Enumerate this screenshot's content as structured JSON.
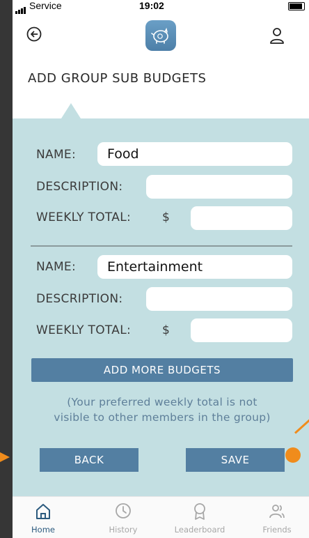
{
  "status_bar": {
    "carrier": "Service",
    "time": "19:02"
  },
  "header": {
    "title": "ADD GROUP SUB BUDGETS"
  },
  "budgets": [
    {
      "name_label": "NAME:",
      "name_value": "Food",
      "description_label": "DESCRIPTION:",
      "description_value": "",
      "weekly_total_label": "WEEKLY TOTAL:",
      "currency": "$",
      "weekly_total_value": ""
    },
    {
      "name_label": "NAME:",
      "name_value": "Entertainment",
      "description_label": "DESCRIPTION:",
      "description_value": "",
      "weekly_total_label": "WEEKLY TOTAL:",
      "currency": "$",
      "weekly_total_value": ""
    }
  ],
  "add_more_label": "ADD MORE BUDGETS",
  "note_line1": "(Your preferred weekly total is not",
  "note_line2": "visible to other members in the group)",
  "buttons": {
    "back": "BACK",
    "save": "SAVE"
  },
  "tabs": [
    {
      "label": "Home",
      "icon": "home-icon",
      "active": true
    },
    {
      "label": "History",
      "icon": "clock-icon",
      "active": false
    },
    {
      "label": "Leaderboard",
      "icon": "award-icon",
      "active": false
    },
    {
      "label": "Friends",
      "icon": "users-icon",
      "active": false
    }
  ],
  "colors": {
    "panel": "#c3dfe2",
    "accent": "#537fa2",
    "annotation": "#f08c1c"
  }
}
